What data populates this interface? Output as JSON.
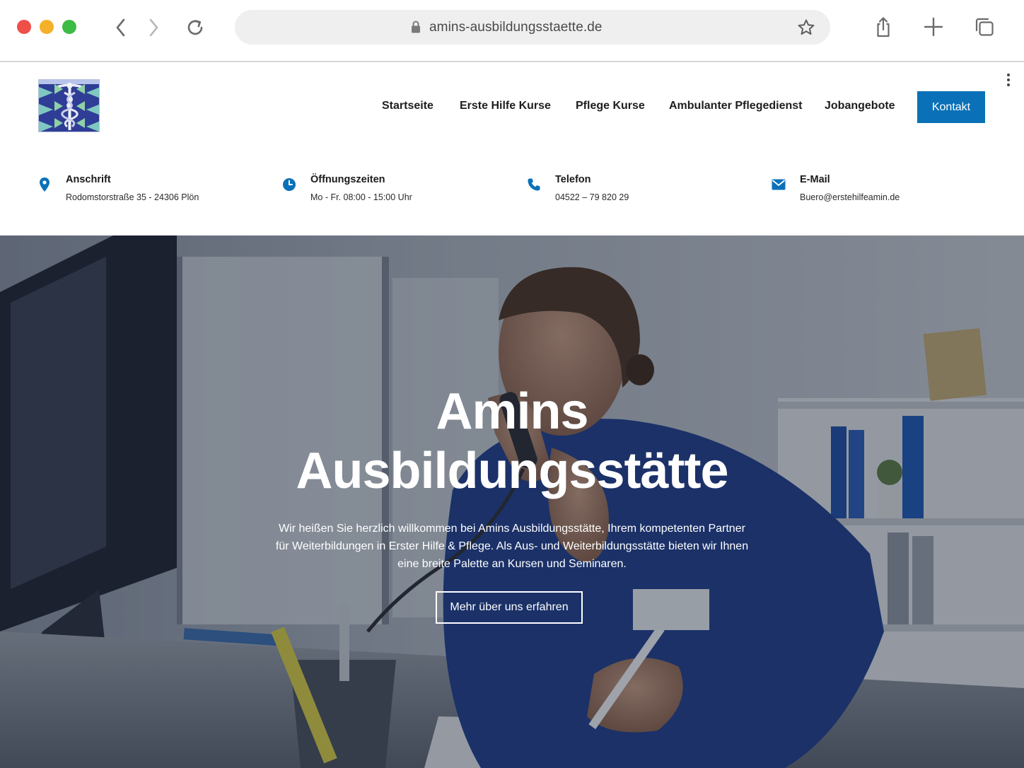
{
  "browser": {
    "url": "amins-ausbildungsstaette.de",
    "icons": {
      "back": "chevron-left-icon",
      "forward": "chevron-right-icon",
      "reload": "reload-icon",
      "lock": "lock-icon",
      "bookmark": "star-icon",
      "share": "share-icon",
      "new_tab": "plus-icon",
      "tabs": "tabs-icon"
    }
  },
  "header": {
    "nav": [
      {
        "label": "Startseite"
      },
      {
        "label": "Erste Hilfe Kurse"
      },
      {
        "label": "Pflege Kurse"
      },
      {
        "label": "Ambulanter Pflegedienst"
      },
      {
        "label": "Jobangebote"
      }
    ],
    "cta_label": "Kontakt",
    "accent_color": "#0a71b8"
  },
  "info": [
    {
      "icon": "map-pin-icon",
      "title": "Anschrift",
      "value": "Rodomstorstraße 35 - 24306 Plön"
    },
    {
      "icon": "clock-icon",
      "title": "Öffnungszeiten",
      "value": "Mo - Fr. 08:00 - 15:00 Uhr"
    },
    {
      "icon": "phone-icon",
      "title": "Telefon",
      "value": "04522 – 79 820 29"
    },
    {
      "icon": "mail-icon",
      "title": "E-Mail",
      "value": "Buero@erstehilfeamin.de"
    }
  ],
  "hero": {
    "title_line1": "Amins",
    "title_line2": "Ausbildungsstätte",
    "text": "Wir heißen Sie herzlich willkommen bei Amins Ausbildungsstätte, Ihrem kompetenten Partner für Weiterbildungen in Erster Hilfe & Pflege. Als Aus- und Weiterbildungsstätte bieten wir Ihnen eine breite Palette an Kursen und Seminaren.",
    "button_label": "Mehr über uns erfahren"
  }
}
